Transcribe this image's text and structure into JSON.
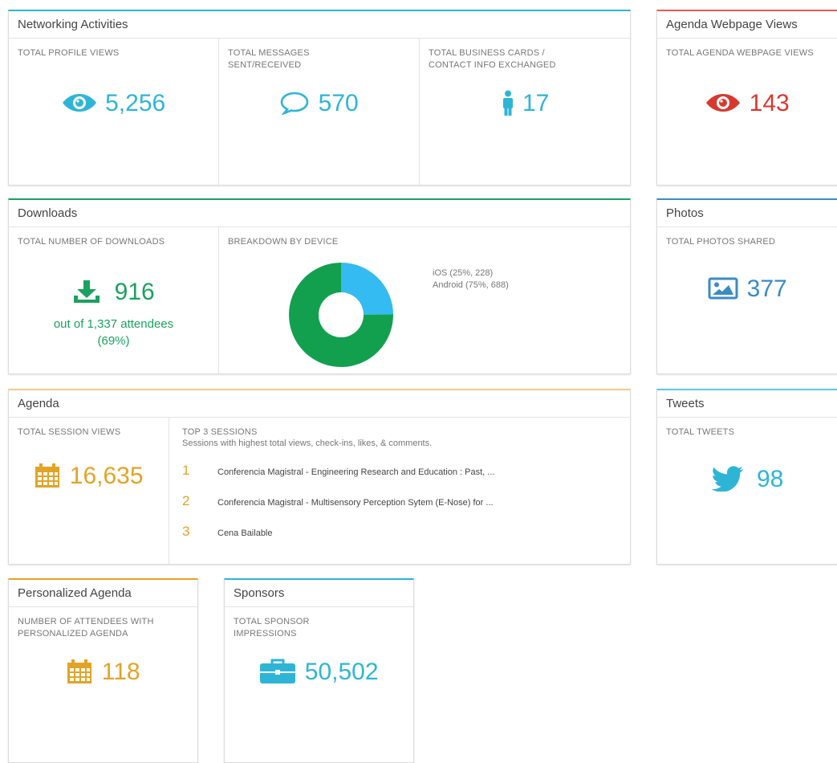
{
  "colors": {
    "teal": "#2eb5d6",
    "red": "#d63a2f",
    "green": "#1aa260",
    "orange": "#e3a327",
    "blue": "#3a8bc4",
    "ios_blue": "#33bbf2",
    "android_green": "#12a04f"
  },
  "networking": {
    "title": "Networking Activities",
    "profile_views_label": "TOTAL PROFILE VIEWS",
    "profile_views_value": "5,256",
    "profile_views_icon": "eye-icon",
    "messages_label": "TOTAL MESSAGES SENT/RECEIVED",
    "messages_value": "570",
    "messages_icon": "chat-bubble-icon",
    "cards_label": "TOTAL BUSINESS CARDS / CONTACT INFO EXCHANGED",
    "cards_value": "17",
    "cards_icon": "person-icon"
  },
  "agenda_web": {
    "title": "Agenda Webpage Views",
    "label": "TOTAL AGENDA WEBPAGE VIEWS",
    "value": "143",
    "icon": "eye-icon"
  },
  "downloads": {
    "title": "Downloads",
    "total_label": "TOTAL NUMBER OF DOWNLOADS",
    "total_value": "916",
    "total_icon": "download-icon",
    "out_of": "out of 1,337 attendees",
    "percent": "(69%)",
    "breakdown_label": "BREAKDOWN BY DEVICE",
    "legend_ios": "iOS (25%, 228)",
    "legend_android": "Android (75%, 688)"
  },
  "chart_data": {
    "type": "pie",
    "donut": true,
    "categories": [
      "iOS",
      "Android"
    ],
    "values": [
      228,
      688
    ],
    "percent": [
      25,
      75
    ],
    "colors": [
      "#33bbf2",
      "#12a04f"
    ]
  },
  "photos": {
    "title": "Photos",
    "label": "TOTAL PHOTOS SHARED",
    "value": "377",
    "icon": "image-icon"
  },
  "agenda": {
    "title": "Agenda",
    "session_views_label": "TOTAL SESSION VIEWS",
    "session_views_value": "16,635",
    "session_views_icon": "calendar-icon",
    "top_label": "TOP 3 SESSIONS",
    "top_sub": "Sessions with highest total views, check-ins, likes, & comments.",
    "sessions": [
      {
        "num": "1",
        "name": "Conferencia Magistral - Engineering Research and Education : Past, ..."
      },
      {
        "num": "2",
        "name": "Conferencia Magistral - Multisensory Perception Sytem (E-Nose) for ..."
      },
      {
        "num": "3",
        "name": "Cena Bailable"
      }
    ]
  },
  "tweets": {
    "title": "Tweets",
    "label": "TOTAL TWEETS",
    "value": "98",
    "icon": "twitter-bird-icon"
  },
  "personal": {
    "title": "Personalized Agenda",
    "label": "NUMBER OF ATTENDEES WITH PERSONALIZED AGENDA",
    "value": "118",
    "icon": "calendar-icon"
  },
  "sponsors": {
    "title": "Sponsors",
    "label": "TOTAL SPONSOR IMPRESSIONS",
    "value": "50,502",
    "icon": "briefcase-icon"
  }
}
